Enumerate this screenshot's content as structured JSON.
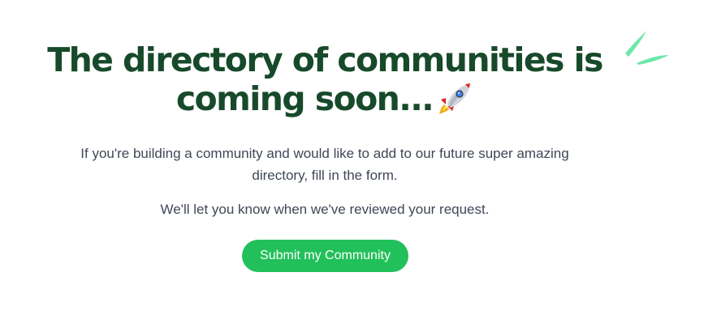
{
  "headline": {
    "line1": "The directory of communities is",
    "line2": "coming soon..."
  },
  "description": {
    "line1": "If you're building a community and would like to add to our future super amazing",
    "line2": "directory, fill in the form."
  },
  "note": "We'll let you know when we've reviewed your request.",
  "cta": {
    "label": "Submit my Community"
  },
  "icons": {
    "rocket": "rocket-icon",
    "decoration": "sparkle-strokes-icon"
  },
  "colors": {
    "headline": "#174a2a",
    "body_text": "#3f4756",
    "accent": "#22c05a",
    "decoration": "#6ee7a7"
  }
}
